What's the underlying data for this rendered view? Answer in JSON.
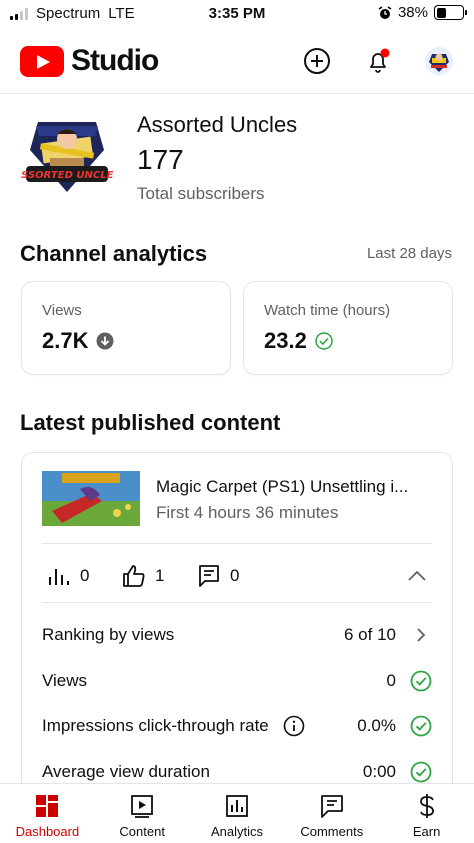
{
  "status_bar": {
    "carrier": "Spectrum",
    "network": "LTE",
    "time": "3:35 PM",
    "battery": "38%",
    "battery_level": 0.38
  },
  "header": {
    "logo_text": "Studio",
    "icons": [
      "create-icon",
      "notifications-icon",
      "account-avatar"
    ],
    "brand_color": "#ff0000"
  },
  "channel": {
    "name": "Assorted Uncles",
    "subscribers": "177",
    "subscribers_label": "Total subscribers"
  },
  "analytics": {
    "title": "Channel analytics",
    "period": "Last 28 days",
    "cards": [
      {
        "label": "Views",
        "value": "2.7K",
        "indicator": "down-arrow-icon"
      },
      {
        "label": "Watch time (hours)",
        "value": "23.2",
        "indicator": "check-circle-icon"
      }
    ]
  },
  "latest": {
    "title": "Latest published content",
    "video": {
      "title": "Magic Carpet (PS1) Unsettling i...",
      "subtitle": "First 4 hours 36 minutes",
      "views": "0",
      "likes": "1",
      "comments": "0"
    },
    "rows": [
      {
        "label": "Ranking by views",
        "value": "6 of 10",
        "icon": "chevron-right-icon"
      },
      {
        "label": "Views",
        "value": "0",
        "icon": "check-circle-icon"
      },
      {
        "label": "Impressions click-through rate",
        "value": "0.0%",
        "icon": "check-circle-icon",
        "info": true
      },
      {
        "label": "Average view duration",
        "value": "0:00",
        "icon": "check-circle-icon"
      }
    ]
  },
  "nav": [
    {
      "label": "Dashboard",
      "icon": "dashboard-icon",
      "active": true
    },
    {
      "label": "Content",
      "icon": "content-icon",
      "active": false
    },
    {
      "label": "Analytics",
      "icon": "analytics-icon",
      "active": false
    },
    {
      "label": "Comments",
      "icon": "comments-icon",
      "active": false
    },
    {
      "label": "Earn",
      "icon": "earn-icon",
      "active": false
    }
  ],
  "colors": {
    "accent": "#cc0000",
    "check_green": "#2ba640",
    "secondary_text": "#606060",
    "notification_dot": "#ff0000"
  }
}
